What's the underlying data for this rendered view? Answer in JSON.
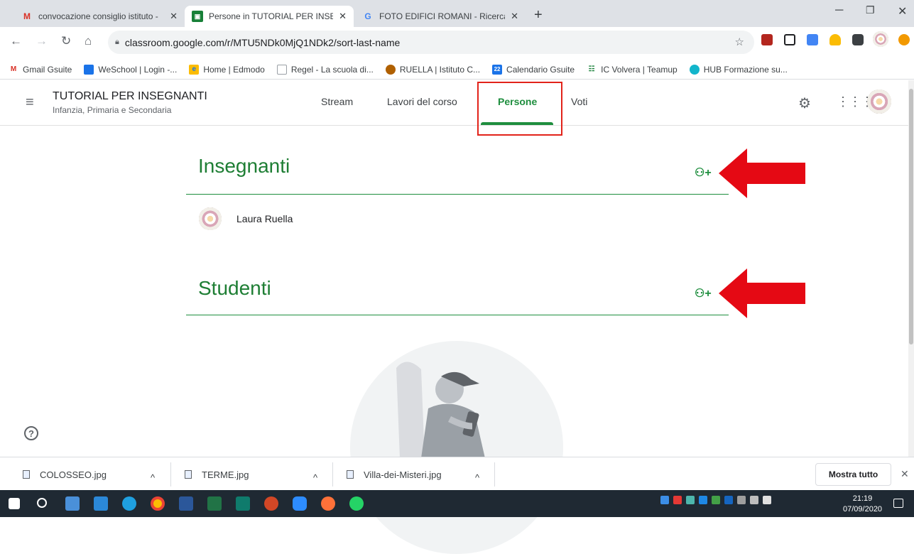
{
  "browser": {
    "tabs": [
      {
        "title": "convocazione consiglio istituto -",
        "favicon": "gmail-icon",
        "active": false
      },
      {
        "title": "Persone in TUTORIAL PER INSEGN",
        "favicon": "classroom-icon",
        "active": true
      },
      {
        "title": "FOTO EDIFICI ROMANI - Ricerca G",
        "favicon": "google-icon",
        "active": false
      }
    ],
    "url": "classroom.google.com/r/MTU5NDk0MjQ1NDk2/sort-last-name",
    "bookmarks": [
      {
        "label": "Gmail Gsuite",
        "icon": "gmail-icon",
        "color": "#d93025"
      },
      {
        "label": "WeSchool | Login -...",
        "icon": "weschool-icon",
        "color": "#1a73e8"
      },
      {
        "label": "Home | Edmodo",
        "icon": "edmodo-icon",
        "color": "#fbbc04"
      },
      {
        "label": "Regel - La scuola di...",
        "icon": "page-icon",
        "color": "#9aa0a6"
      },
      {
        "label": "RUELLA | Istituto C...",
        "icon": "emblem-icon",
        "color": "#b06000"
      },
      {
        "label": "Calendario Gsuite",
        "icon": "calendar-icon",
        "color": "#1a73e8"
      },
      {
        "label": "IC Volvera | Teamup",
        "icon": "teamup-icon",
        "color": "#188038"
      },
      {
        "label": "HUB Formazione su...",
        "icon": "hub-icon",
        "color": "#12b5cb"
      }
    ]
  },
  "classroom": {
    "course_title": "TUTORIAL PER INSEGNANTI",
    "course_subtitle": "Infanzia, Primaria e Secondaria",
    "nav": [
      "Stream",
      "Lavori del corso",
      "Persone",
      "Voti"
    ],
    "active_nav": "Persone",
    "accent_color": "#1e8e3e",
    "teachers_heading": "Insegnanti",
    "students_heading": "Studenti",
    "teachers": [
      {
        "name": "Laura Ruella"
      }
    ]
  },
  "downloads": {
    "files": [
      "COLOSSEO.jpg",
      "TERME.jpg",
      "Villa-dei-Misteri.jpg"
    ],
    "show_all": "Mostra tutto"
  },
  "taskbar": {
    "time": "21:19",
    "date": "07/09/2020"
  }
}
